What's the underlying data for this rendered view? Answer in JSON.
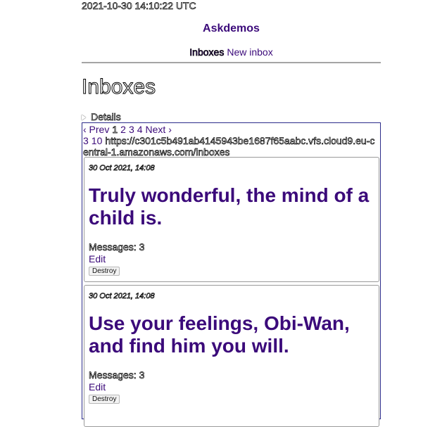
{
  "header": {
    "timestamp": "2021-10-30 14:10:22 UTC",
    "brand": "Askdemos",
    "nav": {
      "inboxes": "Inboxes",
      "new_inbox": "New inbox"
    }
  },
  "main": {
    "title": "Inboxes",
    "details_label": "Details",
    "pager": {
      "prev": "‹ Prev",
      "pages": [
        "1",
        "2",
        "3",
        "4"
      ],
      "next": "Next ›",
      "line2_pages": [
        "3",
        "10"
      ],
      "url": "https://c301c5b491ab4145943be1687f65aabc.vfs.cloud9.eu-central-1.amazonaws.com/inboxes"
    },
    "inboxes": [
      {
        "date": "30 Oct 2021, 14:08",
        "title": "Truly wonderful, the mind of a child is.",
        "messages": "Messages: 3",
        "edit": "Edit",
        "destroy": "Destroy"
      },
      {
        "date": "30 Oct 2021, 14:08",
        "title": "Use your feelings, Obi-Wan, and find him you will.",
        "messages": "Messages: 3",
        "edit": "Edit",
        "destroy": "Destroy"
      }
    ]
  }
}
